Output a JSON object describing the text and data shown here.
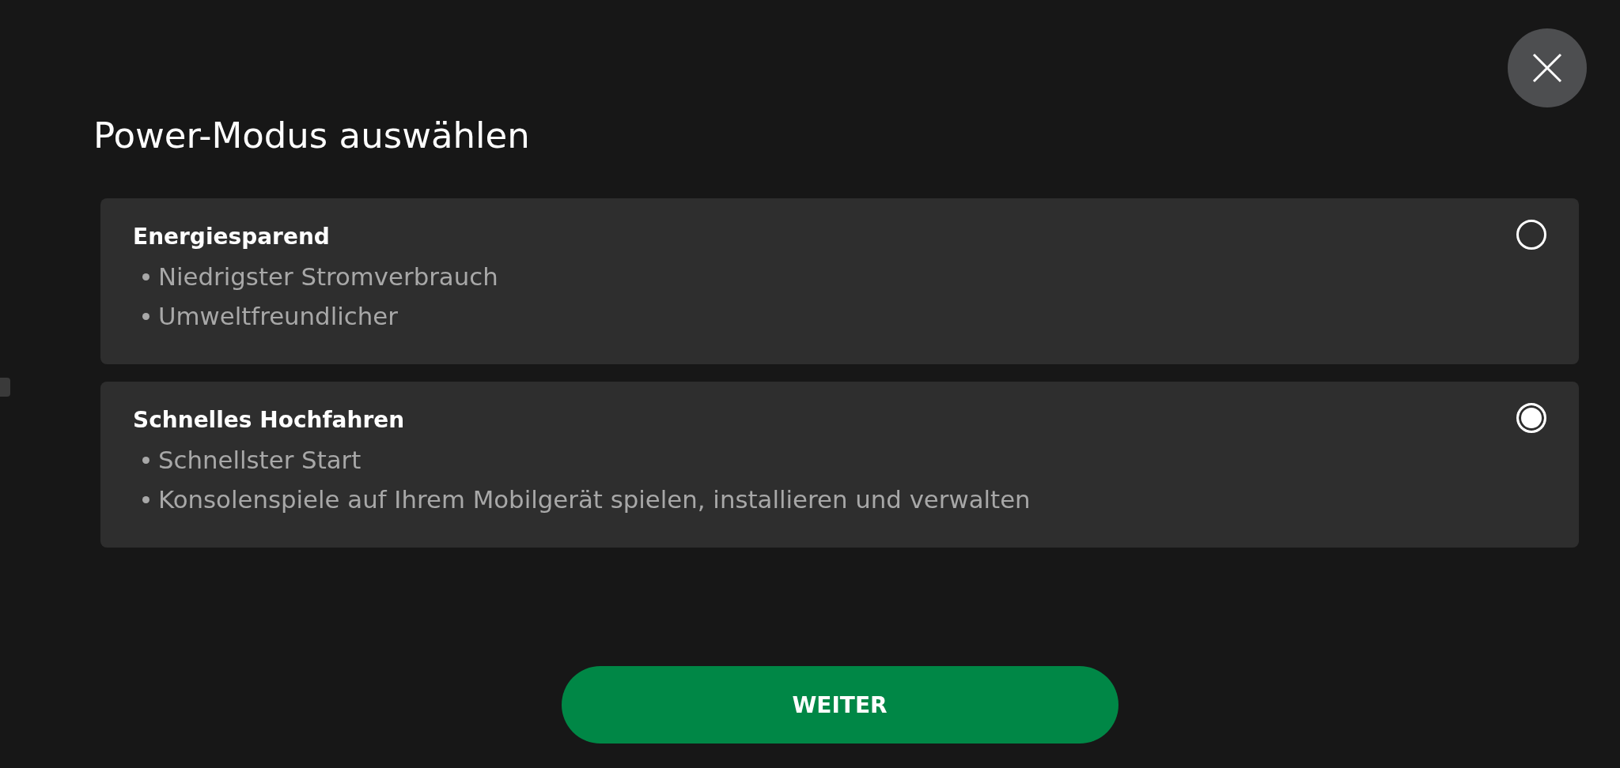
{
  "title": "Power-Modus auswählen",
  "options": [
    {
      "name": "Energiesparend",
      "bullets": [
        "Niedrigster Stromverbrauch",
        "Umweltfreundlicher"
      ],
      "selected": false
    },
    {
      "name": "Schnelles Hochfahren",
      "bullets": [
        "Schnellster Start",
        "Konsolenspiele auf Ihrem Mobilgerät spielen, installieren und verwalten"
      ],
      "selected": true
    }
  ],
  "continue_button": {
    "label": "WEITER"
  }
}
